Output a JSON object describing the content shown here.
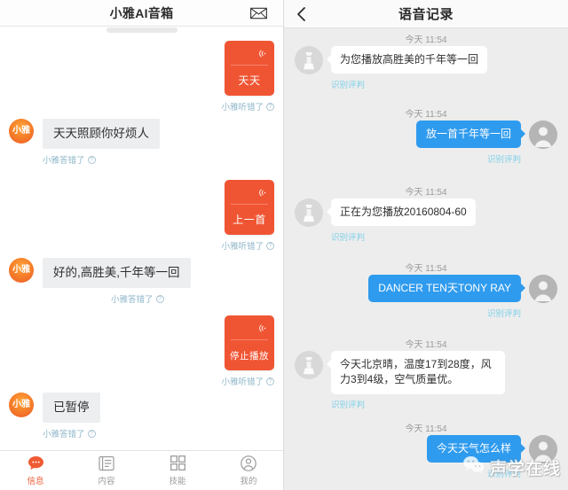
{
  "left": {
    "header": {
      "title": "小雅AI音箱",
      "mail_icon": "envelope-icon"
    },
    "messages": [
      {
        "type": "out-card",
        "icon": "voice-wave-icon",
        "text": "天天",
        "note": "小雅听错了"
      },
      {
        "type": "in",
        "avatar_label": "小雅",
        "text": "天天照顾你好烦人",
        "note": "小雅答错了"
      },
      {
        "type": "out-card",
        "icon": "voice-wave-icon",
        "text": "上一首",
        "note": "小雅听错了"
      },
      {
        "type": "in",
        "avatar_label": "小雅",
        "text": "好的,高胜美,千年等一回",
        "note": "小雅答错了"
      },
      {
        "type": "out-card",
        "icon": "voice-wave-icon",
        "text": "停止播放",
        "note": "小雅听错了"
      },
      {
        "type": "in",
        "avatar_label": "小雅",
        "text": "已暂停",
        "note": "小雅答错了"
      }
    ],
    "tabs": [
      {
        "label": "信息",
        "icon": "chat-bubble-icon",
        "active": true
      },
      {
        "label": "内容",
        "icon": "document-icon",
        "active": false
      },
      {
        "label": "技能",
        "icon": "grid-icon",
        "active": false
      },
      {
        "label": "我的",
        "icon": "person-icon",
        "active": false
      }
    ]
  },
  "right": {
    "header": {
      "title": "语音记录",
      "back_icon": "chevron-left-icon"
    },
    "messages": [
      {
        "side": "in",
        "timestamp": "今天 11:54",
        "text": "为您播放高胜美的千年等一回",
        "note": "识别评判",
        "avatar": "speaker-device-icon"
      },
      {
        "side": "out",
        "timestamp": "今天 11:54",
        "text": "放一首千年等一回",
        "note": "识别评判",
        "avatar": "user-avatar-icon"
      },
      {
        "side": "in",
        "timestamp": "今天 11:54",
        "text": "正在为您播放20160804-60",
        "note": "识别评判",
        "avatar": "speaker-device-icon"
      },
      {
        "side": "out",
        "timestamp": "今天 11:54",
        "text": "DANCER TEN天TONY RAY",
        "note": "识别评判",
        "avatar": "user-avatar-icon"
      },
      {
        "side": "in",
        "timestamp": "今天 11:54",
        "text": "今天北京晴，温度17到28度，风力3到4级，空气质量优。",
        "note": "识别评判",
        "avatar": "speaker-device-icon"
      },
      {
        "side": "out",
        "timestamp": "今天 11:54",
        "text": "今天天气怎么样",
        "note": "识别评判",
        "avatar": "user-avatar-icon"
      }
    ],
    "watermark": {
      "text": "声学在线",
      "icon": "wechat-icon"
    }
  },
  "colors": {
    "orange": "#f05533",
    "blue": "#2f9bee",
    "grey_bubble": "#eceef0",
    "note_left": "#8fb7c9",
    "note_right": "#7fd0e8",
    "right_bg": "#ededed"
  }
}
